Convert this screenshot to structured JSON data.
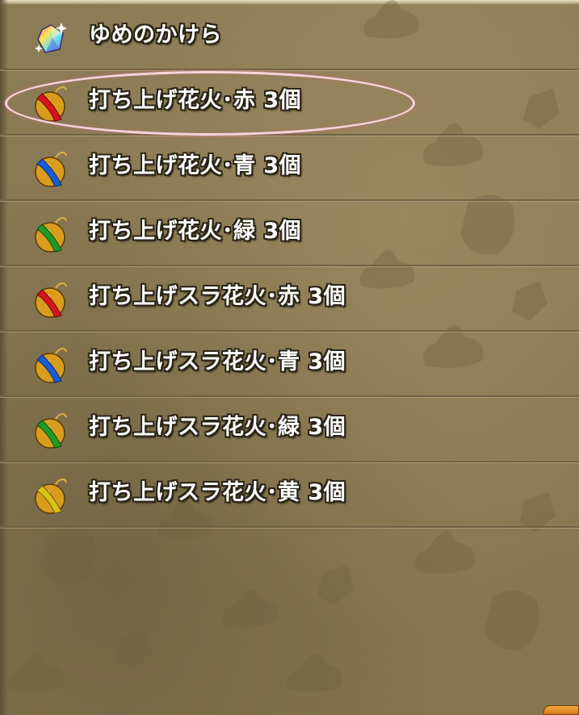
{
  "items": [
    {
      "icon": "dream-fragment-icon",
      "label": "ゆめのかけら"
    },
    {
      "icon": "firework-red-icon",
      "label": "打ち上げ花火･赤 3個",
      "band_color": "#d4141c"
    },
    {
      "icon": "firework-blue-icon",
      "label": "打ち上げ花火･青 3個",
      "band_color": "#1a5bd6"
    },
    {
      "icon": "firework-green-icon",
      "label": "打ち上げ花火･緑 3個",
      "band_color": "#1f9a2a"
    },
    {
      "icon": "slime-firework-red-icon",
      "label": "打ち上げスラ花火･赤 3個",
      "band_color": "#d4141c"
    },
    {
      "icon": "slime-firework-blue-icon",
      "label": "打ち上げスラ花火･青 3個",
      "band_color": "#1a5bd6"
    },
    {
      "icon": "slime-firework-green-icon",
      "label": "打ち上げスラ花火･緑 3個",
      "band_color": "#1f9a2a"
    },
    {
      "icon": "slime-firework-yellow-icon",
      "label": "打ち上げスラ花火･黄 3個",
      "band_color": "#d9c21a"
    }
  ],
  "highlight": {
    "color": "#f3d6dc",
    "target_row": 1
  },
  "colors": {
    "panel_background": "#8a7a54",
    "row_divider": "#6f6243",
    "label_text": "#ffffff",
    "label_outline": "#2b2416",
    "corner_tab": "#f2a93b"
  }
}
